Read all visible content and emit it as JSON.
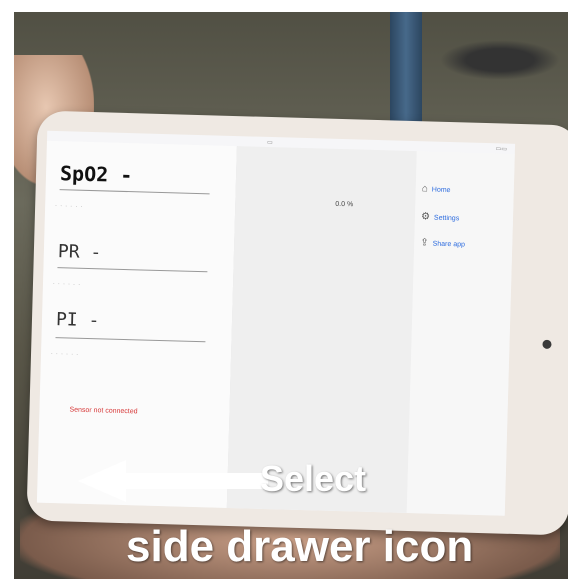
{
  "screen": {
    "metrics": {
      "spo2_label": "SpO2 -",
      "pr_label": "PR -",
      "pi_label": "PI -"
    },
    "warning": "Sensor not connected",
    "value_pct": "0.0 %",
    "menu": [
      {
        "icon": "home-icon",
        "label": "Home"
      },
      {
        "icon": "gear-icon",
        "label": "Settings"
      },
      {
        "icon": "share-icon",
        "label": "Share app"
      }
    ]
  },
  "overlay": {
    "line1": "Select",
    "line2": "side drawer icon"
  },
  "colors": {
    "tablet_frame": "#efe9e3",
    "warning": "#d73939",
    "menu_link": "#2d6cdf",
    "caption": "#ffffff"
  }
}
